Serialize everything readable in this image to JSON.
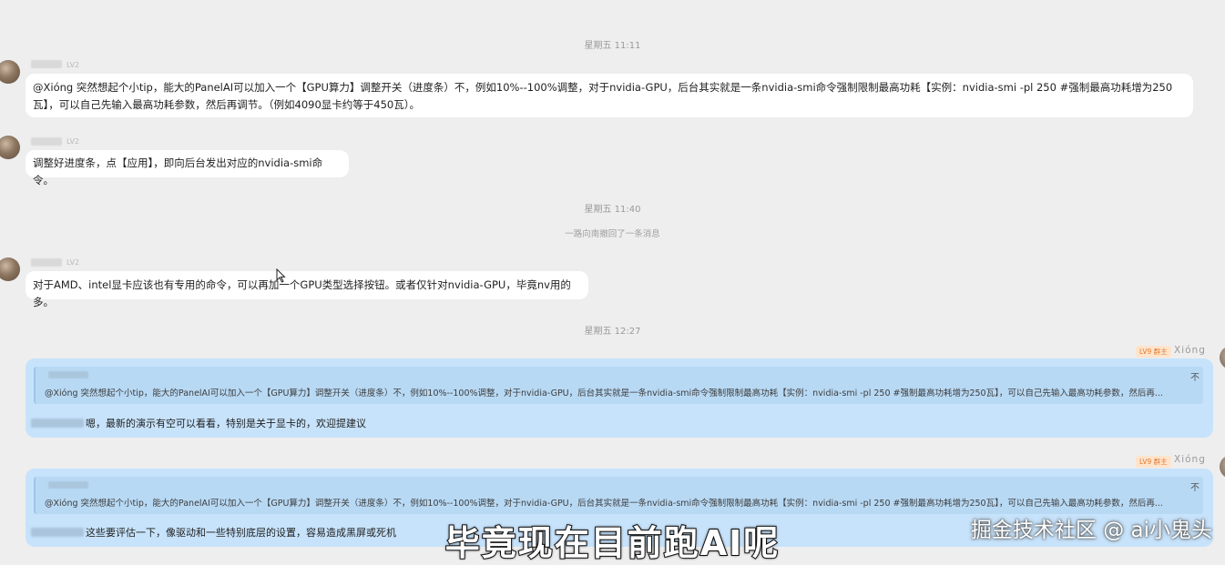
{
  "timestamps": [
    "星期五 11:11",
    "星期五 11:40",
    "星期五 12:27"
  ],
  "recall_notice": "一路向南撤回了一条消息",
  "level_badge": "LV2",
  "messages": [
    {
      "text": "@Xióng 突然想起个小tip，能大的PanelAI可以加入一个【GPU算力】调整开关（进度条）不，例如10%--100%调整，对于nvidia-GPU，后台其实就是一条nvidia-smi命令强制限制最高功耗【实例：nvidia-smi -pl 250  #强制最高功耗增为250瓦】，可以自己先输入最高功耗参数，然后再调节。（例如4090显卡约等于450瓦）。"
    },
    {
      "text": "调整好进度条，点【应用】，即向后台发出对应的nvidia-smi命令。"
    },
    {
      "text": "对于AMD、intel显卡应该也有专用的命令，可以再加一个GPU类型选择按钮。或者仅针对nvidia-GPU，毕竟nv用的多。"
    }
  ],
  "replies": [
    {
      "badge": "LV9 群主",
      "sender": "Xióng",
      "quote_text": "@Xióng 突然想起个小tip，能大的PanelAI可以加入一个【GPU算力】调整开关（进度条）不，例如10%--100%调整，对于nvidia-GPU，后台其实就是一条nvidia-smi命令强制限制最高功耗【实例：nvidia-smi -pl 250  #强制最高功耗增为250瓦】，可以自己先输入最高功耗参数，然后再...",
      "close": "不",
      "text": "嗯，最新的演示有空可以看看，特别是关于显卡的，欢迎提建议"
    },
    {
      "badge": "LV9 群主",
      "sender": "Xióng",
      "quote_text": "@Xióng 突然想起个小tip，能大的PanelAI可以加入一个【GPU算力】调整开关（进度条）不，例如10%--100%调整，对于nvidia-GPU，后台其实就是一条nvidia-smi命令强制限制最高功耗【实例：nvidia-smi -pl 250  #强制最高功耗增为250瓦】，可以自己先输入最高功耗参数，然后再...",
      "close": "不",
      "text": "这些要评估一下，像驱动和一些特别底层的设置，容易造成黑屏或死机"
    }
  ],
  "video_subtitle": "毕竟现在目前跑AI呢",
  "watermark": "掘金技术社区 @ ai小鬼头"
}
